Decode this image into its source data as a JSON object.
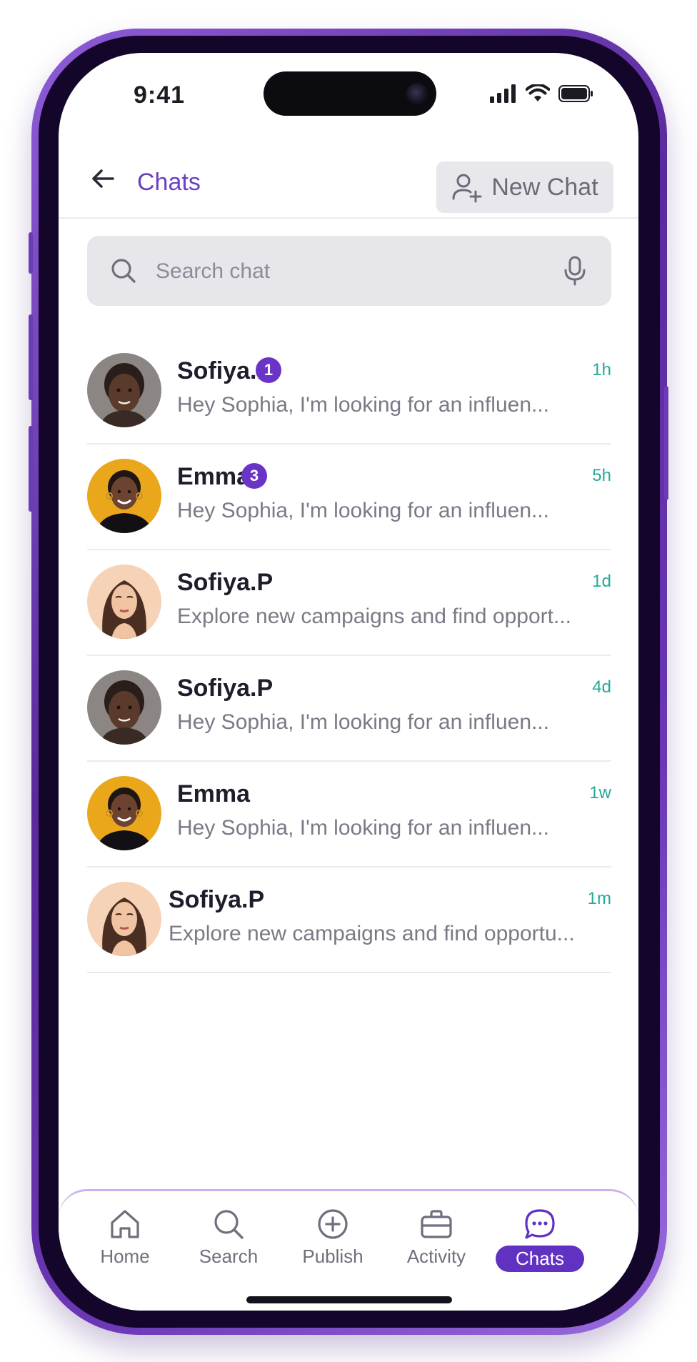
{
  "status_bar": {
    "time": "9:41"
  },
  "header": {
    "title": "Chats",
    "new_chat_label": "New Chat"
  },
  "search": {
    "placeholder": "Search chat"
  },
  "chats": [
    {
      "name": "Sofiya.P",
      "badge": "1",
      "time": "1h",
      "preview": "Hey Sophia, I'm looking for an influen...",
      "avatar": "dark-braids"
    },
    {
      "name": "Emma",
      "badge": "3",
      "time": "5h",
      "preview": "Hey Sophia, I'm looking for an influen...",
      "avatar": "yellow-bg"
    },
    {
      "name": "Sofiya.P",
      "badge": "",
      "time": "1d",
      "preview": "Explore new campaigns and find opport...",
      "avatar": "illustrated"
    },
    {
      "name": "Sofiya.P",
      "badge": "",
      "time": "4d",
      "preview": "Hey Sophia, I'm looking for an influen...",
      "avatar": "dark-braids"
    },
    {
      "name": "Emma",
      "badge": "",
      "time": "1w",
      "preview": "Hey Sophia, I'm looking for an influen...",
      "avatar": "yellow-bg"
    },
    {
      "name": "Sofiya.P",
      "badge": "",
      "time": "1m",
      "preview": "Explore new campaigns and find opportu...",
      "avatar": "illustrated"
    }
  ],
  "nav": {
    "items": [
      {
        "label": "Home",
        "icon": "home-icon"
      },
      {
        "label": "Search",
        "icon": "search-icon"
      },
      {
        "label": "Publish",
        "icon": "plus-circle-icon"
      },
      {
        "label": "Activity",
        "icon": "briefcase-icon"
      },
      {
        "label": "Chats",
        "icon": "chat-bubble-icon",
        "active": true
      }
    ]
  },
  "colors": {
    "accent": "#6131c2",
    "time": "#24a99b",
    "frame": "#6b37b5"
  }
}
